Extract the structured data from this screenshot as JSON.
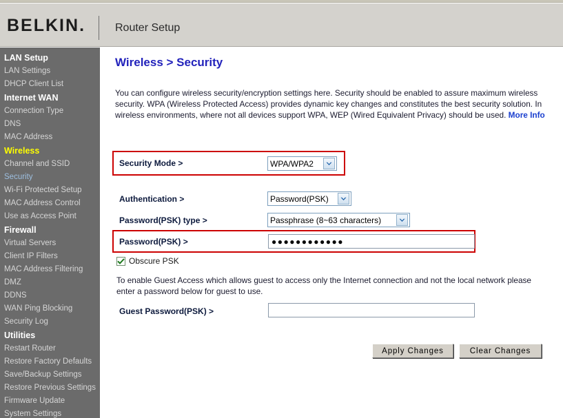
{
  "header": {
    "brand": "BELKIN",
    "brand_dot": ".",
    "title": "Router Setup"
  },
  "sidebar": {
    "groups": [
      {
        "title": "LAN Setup",
        "items": [
          {
            "label": "LAN Settings",
            "active": false
          },
          {
            "label": "DHCP Client List",
            "active": false
          }
        ]
      },
      {
        "title": "Internet WAN",
        "items": [
          {
            "label": "Connection Type",
            "active": false
          },
          {
            "label": "DNS",
            "active": false
          },
          {
            "label": "MAC Address",
            "active": false
          }
        ]
      },
      {
        "title": "Wireless",
        "accent": true,
        "items": [
          {
            "label": "Channel and SSID",
            "active": false
          },
          {
            "label": "Security",
            "active": true
          },
          {
            "label": "Wi-Fi Protected Setup",
            "active": false
          },
          {
            "label": "MAC Address Control",
            "active": false
          },
          {
            "label": "Use as Access Point",
            "active": false
          }
        ]
      },
      {
        "title": "Firewall",
        "items": [
          {
            "label": "Virtual Servers",
            "active": false
          },
          {
            "label": "Client IP Filters",
            "active": false
          },
          {
            "label": "MAC Address Filtering",
            "active": false
          },
          {
            "label": "DMZ",
            "active": false
          },
          {
            "label": "DDNS",
            "active": false
          },
          {
            "label": "WAN Ping Blocking",
            "active": false
          },
          {
            "label": "Security Log",
            "active": false
          }
        ]
      },
      {
        "title": "Utilities",
        "items": [
          {
            "label": "Restart Router",
            "active": false
          },
          {
            "label": "Restore Factory Defaults",
            "active": false
          },
          {
            "label": "Save/Backup Settings",
            "active": false
          },
          {
            "label": "Restore Previous Settings",
            "active": false
          },
          {
            "label": "Firmware Update",
            "active": false
          },
          {
            "label": "System Settings",
            "active": false
          }
        ]
      }
    ]
  },
  "main": {
    "heading": "Wireless > Security",
    "intro_text": "You can configure wireless security/encryption settings here. Security should be enabled to assure maximum wireless security. WPA (Wireless Protected Access) provides dynamic key changes and constitutes the best security solution. In wireless environments, where not all devices support WPA, WEP (Wired Equivalent Privacy) should be used. ",
    "more_info_label": "More Info",
    "fields": {
      "security_mode": {
        "label": "Security Mode >",
        "value": "WPA/WPA2"
      },
      "authentication": {
        "label": "Authentication >",
        "value": "Password(PSK)"
      },
      "psk_type": {
        "label": "Password(PSK) type >",
        "value": "Passphrase (8~63 characters)"
      },
      "password": {
        "label": "Password(PSK) >",
        "value": "●●●●●●●●●●●●",
        "placeholder": ""
      },
      "guest_password": {
        "label": "Guest Password(PSK) >",
        "value": "",
        "placeholder": ""
      }
    },
    "obscure_psk": {
      "label": "Obscure PSK",
      "checked": true
    },
    "guest_note": "To enable Guest Access which allows guest to access only the Internet connection and not the local network please enter a password below for guest to use.",
    "buttons": {
      "apply": "Apply Changes",
      "clear": "Clear Changes"
    }
  },
  "colors": {
    "header_bg": "#d4d2cd",
    "sidebar_bg": "#6b6b6b",
    "accent_yellow": "#ffff00",
    "active_link": "#9dbfe0",
    "heading_blue": "#2222bb",
    "highlight_red": "#cc0000"
  }
}
